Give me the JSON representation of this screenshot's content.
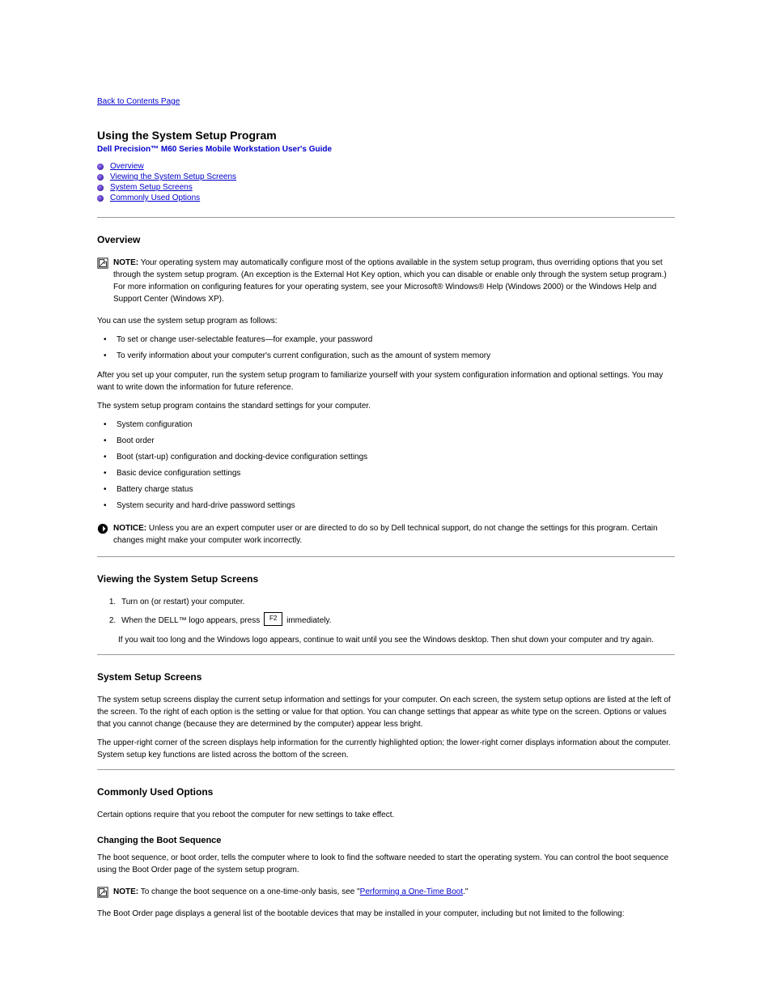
{
  "nav": {
    "back": "Back to Contents Page"
  },
  "header": {
    "title": "Using the System Setup Program",
    "subtitle": "Dell Precision™ M60 Series Mobile Workstation User's Guide"
  },
  "toc": [
    {
      "label": "Overview"
    },
    {
      "label": "Viewing the System Setup Screens"
    },
    {
      "label": "System Setup Screens"
    },
    {
      "label": "Commonly Used Options"
    }
  ],
  "overview": {
    "heading": "Overview",
    "note": "Your operating system may automatically configure most of the options available in the system setup program, thus overriding options that you set through the system setup program. (An exception is the External Hot Key option, which you can disable or enable only through the system setup program.) For more information on configuring features for your operating system, see your Microsoft® Windows® Help (Windows 2000) or the Windows Help and Support Center (Windows XP).",
    "intro": "You can use the system setup program as follows:",
    "bullets": [
      "To set or change user-selectable features—for example, your password",
      "To verify information about your computer's current configuration, such as the amount of system memory"
    ],
    "after": "After you set up your computer, run the system setup program to familiarize yourself with your system configuration information and optional settings. You may want to write down the information for future reference.",
    "purpose_intro": "The system setup program contains the standard settings for your computer.",
    "purpose_bullets": [
      "System configuration",
      "Boot order",
      "Boot (start-up) configuration and docking-device configuration settings",
      "Basic device configuration settings",
      "Battery charge status",
      "System security and hard-drive password settings"
    ],
    "notice": "Unless you are an expert computer user or are directed to do so by Dell technical support, do not change the settings for this program. Certain changes might make your computer work incorrectly."
  },
  "viewing": {
    "heading": "Viewing the System Setup Screens",
    "steps": [
      "Turn on (or restart) your computer.",
      "immediately."
    ],
    "step2_prefix": "When the DELL™ logo appears, press",
    "key": "F2",
    "wait_text": "If you wait too long and the Windows logo appears, continue to wait until you see the Windows desktop. Then shut down your computer and try again."
  },
  "screens": {
    "heading": "System Setup Screens",
    "p1": "The system setup screens display the current setup information and settings for your computer. On each screen, the system setup options are listed at the left of the screen. To the right of each option is the setting or value for that option. You can change settings that appear as white type on the screen. Options or values that you cannot change (because they are determined by the computer) appear less bright.",
    "p2": "The upper-right corner of the screen displays help information for the currently highlighted option; the lower-right corner displays information about the computer. System setup key functions are listed across the bottom of the screen."
  },
  "options": {
    "heading": "Commonly Used Options",
    "reboot": "Certain options require that you reboot the computer for new settings to take effect.",
    "boot_heading": "Changing the Boot Sequence",
    "boot_p1_before": "The boot sequence, or boot order, tells the computer where to look to find the software needed to start the operating system. You can control the boot sequence using the Boot Order page of the system setup program.",
    "boot_p2": "The Boot Order page displays a general list of the bootable devices that may be installed in your computer, including but not limited to the following:",
    "note_boot": "To change the boot sequence on a one-time-only basis, see \"",
    "note_boot_link": "Performing a One-Time Boot",
    "note_boot_after": ".\""
  }
}
